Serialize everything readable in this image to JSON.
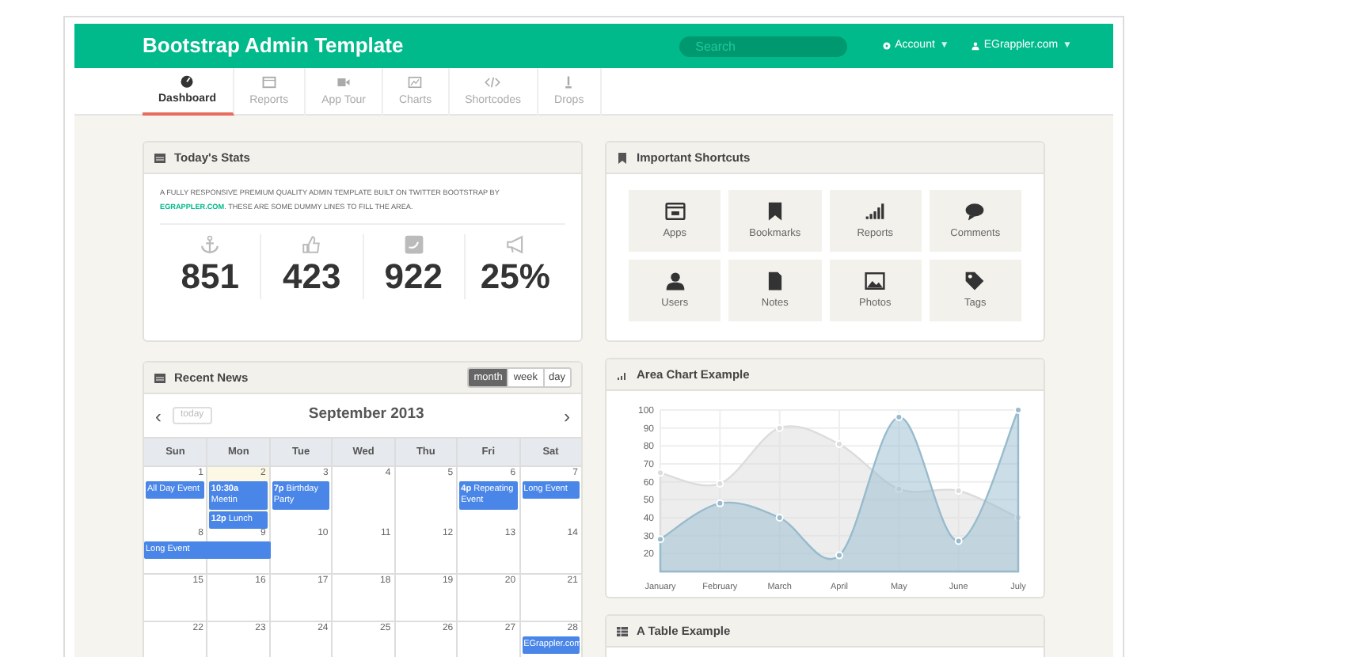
{
  "header": {
    "title": "Bootstrap Admin Template",
    "search": {
      "placeholder": "Search"
    },
    "menus": [
      {
        "label": "Account",
        "caret": "▼"
      },
      {
        "label": "EGrappler.com",
        "caret": "▼"
      }
    ]
  },
  "nav": [
    {
      "label": "Dashboard",
      "selected": true
    },
    {
      "label": "Reports",
      "selected": false
    },
    {
      "label": "App Tour",
      "selected": false
    },
    {
      "label": "Charts",
      "selected": false
    },
    {
      "label": "Shortcodes",
      "selected": false
    },
    {
      "label": "Drops",
      "selected": false
    }
  ],
  "stats": {
    "title": "Today's Stats",
    "intro_before": "A FULLY RESPONSIVE PREMIUM QUALITY ADMIN TEMPLATE BUILT ON TWITTER BOOTSTRAP BY ",
    "intro_link": "EGRAPPLER.COM",
    "intro_after": ". THESE ARE SOME DUMMY LINES TO FILL THE AREA.",
    "values": [
      "851",
      "423",
      "922",
      "25%"
    ]
  },
  "shortcuts": {
    "title": "Important Shortcuts",
    "labels": [
      "Apps",
      "Bookmarks",
      "Reports",
      "Comments",
      "Users",
      "Notes",
      "Photos",
      "Tags"
    ]
  },
  "news": {
    "title": "Recent News",
    "views": [
      {
        "label": "month",
        "selected": true
      },
      {
        "label": "week",
        "selected": false
      },
      {
        "label": "day",
        "selected": false
      }
    ],
    "prev": "‹",
    "today_button": "today",
    "month": "September 2013",
    "next": "›",
    "weekdays": [
      "Sun",
      "Mon",
      "Tue",
      "Wed",
      "Thu",
      "Fri",
      "Sat"
    ],
    "weeks": [
      [
        {
          "date": "1",
          "today": false,
          "events": [
            {
              "text": "All Day Event",
              "continues": false
            }
          ]
        },
        {
          "date": "2",
          "today": true,
          "events": [
            {
              "text": "**10:30a** Meetin",
              "continues": false
            },
            {
              "text": "**12p** Lunch",
              "continues": false
            }
          ]
        },
        {
          "date": "3",
          "today": false,
          "events": [
            {
              "text": "**7p** Birthday Party",
              "continues": false
            }
          ]
        },
        {
          "date": "4",
          "today": false
        },
        {
          "date": "5",
          "today": false
        },
        {
          "date": "6",
          "today": false,
          "events": [
            {
              "text": "**4p** Repeating Event",
              "continues": false
            }
          ]
        },
        {
          "date": "7",
          "today": false,
          "events": [
            {
              "text": "Long Event",
              "continues": false
            }
          ]
        }
      ],
      [
        {
          "date": "8",
          "today": false,
          "events": [
            {
              "text": "Long Event",
              "continues": true
            }
          ]
        },
        {
          "date": "9",
          "today": false
        },
        {
          "date": "10",
          "today": false
        },
        {
          "date": "11",
          "today": false
        },
        {
          "date": "12",
          "today": false
        },
        {
          "date": "13",
          "today": false
        },
        {
          "date": "14",
          "today": false
        }
      ],
      [
        {
          "date": "15",
          "today": false
        },
        {
          "date": "16",
          "today": false
        },
        {
          "date": "17",
          "today": false
        },
        {
          "date": "18",
          "today": false
        },
        {
          "date": "19",
          "today": false
        },
        {
          "date": "20",
          "today": false
        },
        {
          "date": "21",
          "today": false
        }
      ],
      [
        {
          "date": "22",
          "today": false
        },
        {
          "date": "23",
          "today": false
        },
        {
          "date": "24",
          "today": false
        },
        {
          "date": "25",
          "today": false
        },
        {
          "date": "26",
          "today": false
        },
        {
          "date": "27",
          "today": false
        },
        {
          "date": "28",
          "today": false,
          "events": [
            {
              "text": "EGrappler.com",
              "continues": false
            }
          ]
        }
      ]
    ]
  },
  "area_chart": {
    "title": "Area Chart Example",
    "chart_data": {
      "type": "area",
      "grid": true,
      "categories": [
        "January",
        "February",
        "March",
        "April",
        "May",
        "June",
        "July"
      ],
      "ylim": [
        10,
        100
      ],
      "yticks": [
        20,
        30,
        40,
        50,
        60,
        70,
        80,
        90,
        100
      ],
      "series": [
        {
          "color": "#dcdcdc",
          "values": [
            65,
            59,
            90,
            81,
            56,
            55,
            40
          ]
        },
        {
          "color": "#97bbcd",
          "values": [
            28,
            48,
            40,
            19,
            96,
            27,
            100
          ]
        }
      ]
    }
  },
  "table": {
    "title": "A Table Example"
  }
}
